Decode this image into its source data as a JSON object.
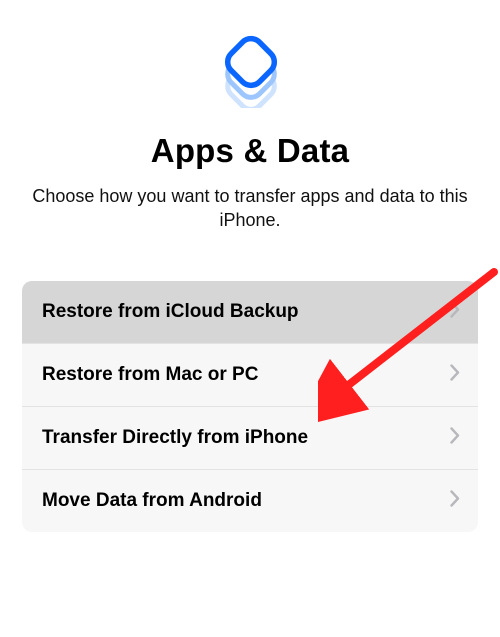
{
  "header": {
    "title": "Apps & Data",
    "subtitle": "Choose how you want to transfer apps and data to this iPhone."
  },
  "options": [
    {
      "label": "Restore from iCloud Backup",
      "highlighted": true
    },
    {
      "label": "Restore from Mac or PC",
      "highlighted": false
    },
    {
      "label": "Transfer Directly from iPhone",
      "highlighted": false
    },
    {
      "label": "Move Data from Android",
      "highlighted": false
    }
  ],
  "colors": {
    "accent": "#0a66ff",
    "arrow": "#ff1f1f"
  }
}
